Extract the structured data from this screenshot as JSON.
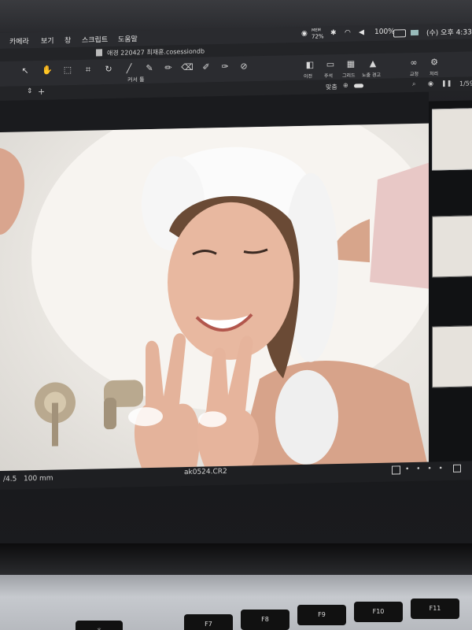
{
  "menubar": {
    "items": [
      "카메라",
      "보기",
      "창",
      "스크립트",
      "도움말"
    ],
    "status": {
      "memory_label": "MEM",
      "memory_value": "72%",
      "battery": "100%",
      "datetime": "(수) 오후 4:33"
    }
  },
  "title": {
    "session": "애경 220427 최재훈.cosessiondb"
  },
  "toolbar": {
    "cursor_label": "커서 툴",
    "right_labels": [
      "이전",
      "주석",
      "그리드",
      "노출 경고"
    ],
    "far_right_labels": [
      "교정",
      "처리"
    ]
  },
  "subbar": {
    "fit_label": "맞춤",
    "counter": "1/59"
  },
  "photo": {
    "alt": "ak0524.CR2"
  },
  "infobar": {
    "aperture": "/4.5",
    "focal_length": "100 mm",
    "filename": "ak0524.CR2"
  },
  "keyboard": {
    "keys": [
      "F7",
      "F8",
      "F9",
      "F10",
      "F11"
    ]
  },
  "colors": {
    "menubar": "#2a2b2f",
    "toolbar": "#2b2c30",
    "viewer_bg": "#1a1b1e",
    "photo_bg": "#eeeae5"
  },
  "icons": [
    "cursor-icon",
    "hand-icon",
    "crop-icon",
    "rotate-icon",
    "pen-icon",
    "brush-icon",
    "eraser-icon",
    "grid-icon",
    "warning-icon",
    "glasses-icon",
    "gear-icon",
    "search-icon",
    "eye-icon"
  ]
}
